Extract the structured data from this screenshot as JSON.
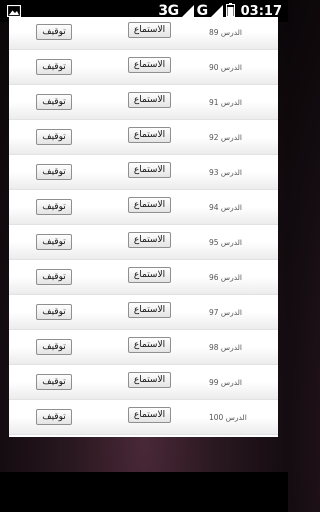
{
  "status_bar": {
    "network_label": "3G",
    "network2_label": "G",
    "time": "03:17"
  },
  "lessons": {
    "items": [
      {
        "title": "الدرس 89",
        "listen_label": "الاستماع",
        "stop_label": "توقيف"
      },
      {
        "title": "الدرس 90",
        "listen_label": "الاستماع",
        "stop_label": "توقيف"
      },
      {
        "title": "الدرس 91",
        "listen_label": "الاستماع",
        "stop_label": "توقيف"
      },
      {
        "title": "الدرس 92",
        "listen_label": "الاستماع",
        "stop_label": "توقيف"
      },
      {
        "title": "الدرس 93",
        "listen_label": "الاستماع",
        "stop_label": "توقيف"
      },
      {
        "title": "الدرس 94",
        "listen_label": "الاستماع",
        "stop_label": "توقيف"
      },
      {
        "title": "الدرس 95",
        "listen_label": "الاستماع",
        "stop_label": "توقيف"
      },
      {
        "title": "الدرس 96",
        "listen_label": "الاستماع",
        "stop_label": "توقيف"
      },
      {
        "title": "الدرس 97",
        "listen_label": "الاستماع",
        "stop_label": "توقيف"
      },
      {
        "title": "الدرس 98",
        "listen_label": "الاستماع",
        "stop_label": "توقيف"
      },
      {
        "title": "الدرس 99",
        "listen_label": "الاستماع",
        "stop_label": "توقيف"
      },
      {
        "title": "الدرس 100",
        "listen_label": "الاستماع",
        "stop_label": "توقيف"
      }
    ]
  }
}
